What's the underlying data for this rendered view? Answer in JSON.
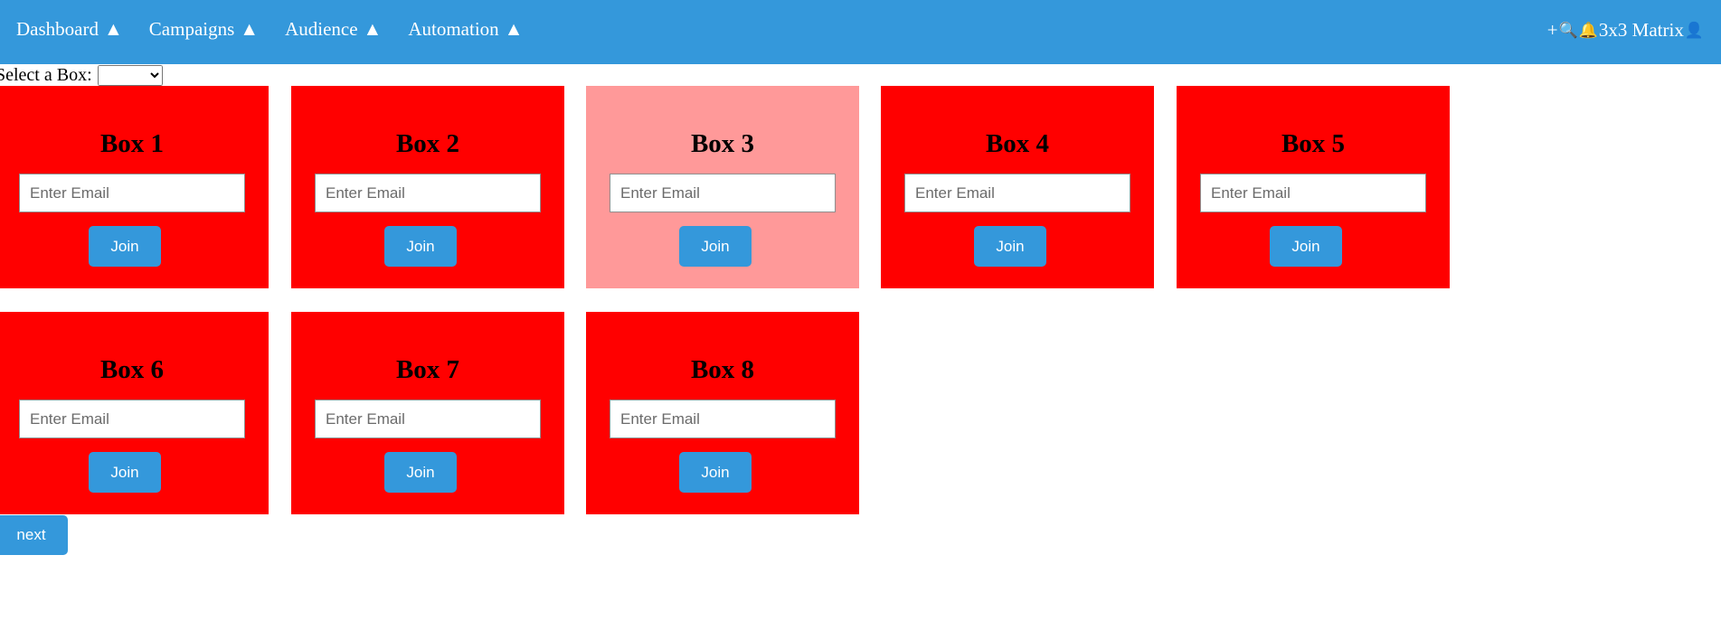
{
  "nav": {
    "items": [
      {
        "label": "Dashboard",
        "caret": "▲"
      },
      {
        "label": "Campaigns",
        "caret": "▲"
      },
      {
        "label": "Audience",
        "caret": "▲"
      },
      {
        "label": "Automation",
        "caret": "▲"
      }
    ]
  },
  "toolbar": {
    "plus": "+",
    "search_icon": "🔍",
    "bell_icon": "🔔",
    "title": "3x3 Matrix",
    "user_icon": "👤"
  },
  "selector": {
    "label": "Select a Box:",
    "value": ""
  },
  "boxes": [
    {
      "title": "Box 1",
      "placeholder": "Enter Email",
      "button": "Join",
      "selected": false
    },
    {
      "title": "Box 2",
      "placeholder": "Enter Email",
      "button": "Join",
      "selected": false
    },
    {
      "title": "Box 3",
      "placeholder": "Enter Email",
      "button": "Join",
      "selected": true
    },
    {
      "title": "Box 4",
      "placeholder": "Enter Email",
      "button": "Join",
      "selected": false
    },
    {
      "title": "Box 5",
      "placeholder": "Enter Email",
      "button": "Join",
      "selected": false
    },
    {
      "title": "Box 6",
      "placeholder": "Enter Email",
      "button": "Join",
      "selected": false
    },
    {
      "title": "Box 7",
      "placeholder": "Enter Email",
      "button": "Join",
      "selected": false
    },
    {
      "title": "Box 8",
      "placeholder": "Enter Email",
      "button": "Join",
      "selected": false
    }
  ],
  "next_button": "next",
  "colors": {
    "accent": "#3498db",
    "box_default": "#ff0000",
    "box_selected": "#ff9999"
  }
}
